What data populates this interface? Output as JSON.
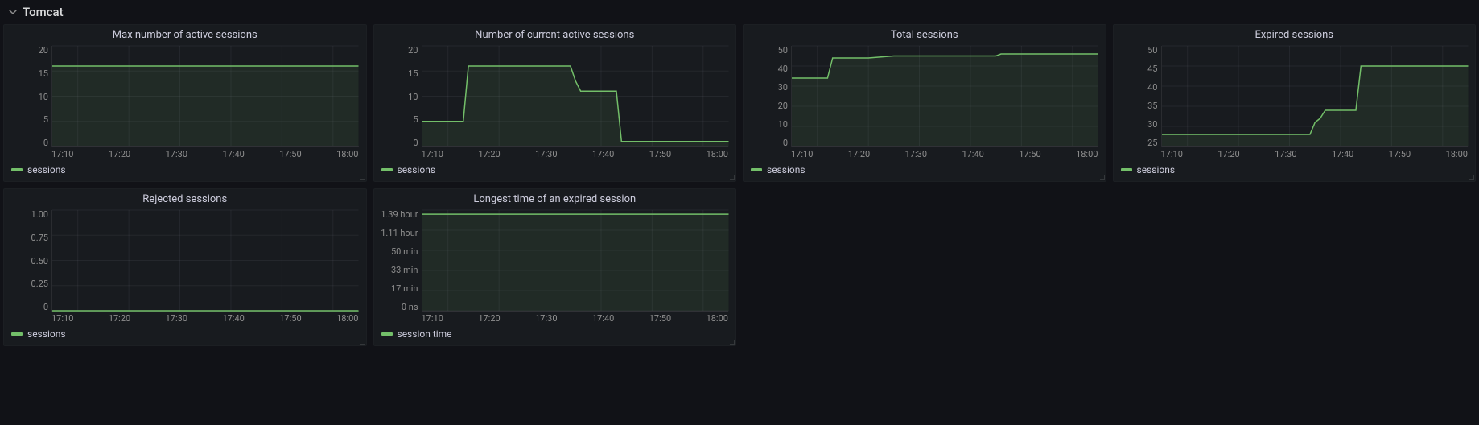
{
  "section": {
    "title": "Tomcat"
  },
  "x_ticks": [
    "17:10",
    "17:20",
    "17:30",
    "17:40",
    "17:50",
    "18:00"
  ],
  "colors": {
    "series": "#73bf69"
  },
  "chart_data": [
    {
      "id": "max-active",
      "type": "line",
      "title": "Max number of active sessions",
      "legend": "sessions",
      "ylim": [
        0,
        20
      ],
      "y_ticks": [
        "20",
        "15",
        "10",
        "5",
        "0"
      ],
      "x": [
        "17:05",
        "17:10",
        "17:15",
        "17:20",
        "17:25",
        "17:30",
        "17:35",
        "17:40",
        "17:45",
        "17:50",
        "17:55",
        "18:00",
        "18:05"
      ],
      "values": [
        16,
        16,
        16,
        16,
        16,
        16,
        16,
        16,
        16,
        16,
        16,
        16,
        16
      ]
    },
    {
      "id": "current-active",
      "type": "line",
      "title": "Number of current active sessions",
      "legend": "sessions",
      "ylim": [
        0,
        20
      ],
      "y_ticks": [
        "20",
        "15",
        "10",
        "5",
        "0"
      ],
      "x": [
        "17:05",
        "17:10",
        "17:13",
        "17:14",
        "17:20",
        "17:25",
        "17:30",
        "17:34",
        "17:35",
        "17:36",
        "17:43",
        "17:44",
        "17:50",
        "17:55",
        "18:00",
        "18:05"
      ],
      "values": [
        5,
        5,
        5,
        16,
        16,
        16,
        16,
        16,
        13,
        11,
        11,
        1,
        1,
        1,
        1,
        1
      ]
    },
    {
      "id": "total-sessions",
      "type": "line",
      "title": "Total sessions",
      "legend": "sessions",
      "ylim": [
        0,
        50
      ],
      "y_ticks": [
        "50",
        "40",
        "30",
        "20",
        "10",
        "0"
      ],
      "x": [
        "17:05",
        "17:10",
        "17:12",
        "17:13",
        "17:20",
        "17:25",
        "17:30",
        "17:35",
        "17:40",
        "17:45",
        "17:46",
        "17:50",
        "17:55",
        "18:00",
        "18:05"
      ],
      "values": [
        34,
        34,
        34,
        44,
        44,
        45,
        45,
        45,
        45,
        45,
        46,
        46,
        46,
        46,
        46
      ]
    },
    {
      "id": "expired-sessions",
      "type": "line",
      "title": "Expired sessions",
      "legend": "sessions",
      "ylim": [
        25,
        50
      ],
      "y_ticks": [
        "50",
        "45",
        "40",
        "35",
        "30",
        "25"
      ],
      "x": [
        "17:05",
        "17:10",
        "17:15",
        "17:20",
        "17:25",
        "17:30",
        "17:34",
        "17:35",
        "17:36",
        "17:37",
        "17:43",
        "17:44",
        "17:50",
        "17:55",
        "18:00",
        "18:05"
      ],
      "values": [
        28,
        28,
        28,
        28,
        28,
        28,
        28,
        31,
        32,
        34,
        34,
        45,
        45,
        45,
        45,
        45
      ]
    },
    {
      "id": "rejected-sessions",
      "type": "line",
      "title": "Rejected sessions",
      "legend": "sessions",
      "ylim": [
        0,
        1
      ],
      "y_ticks": [
        "1.00",
        "0.75",
        "0.50",
        "0.25",
        "0"
      ],
      "x": [
        "17:05",
        "17:10",
        "17:15",
        "17:20",
        "17:25",
        "17:30",
        "17:35",
        "17:40",
        "17:45",
        "17:50",
        "17:55",
        "18:00",
        "18:05"
      ],
      "values": [
        0,
        0,
        0,
        0,
        0,
        0,
        0,
        0,
        0,
        0,
        0,
        0,
        0
      ]
    },
    {
      "id": "longest-expired",
      "type": "line",
      "title": "Longest time of an expired session",
      "legend": "session time",
      "ylim": [
        0,
        5004
      ],
      "y_ticks": [
        "1.39 hour",
        "1.11 hour",
        "50 min",
        "33 min",
        "17 min",
        "0 ns"
      ],
      "x": [
        "17:05",
        "17:10",
        "17:15",
        "17:20",
        "17:25",
        "17:30",
        "17:35",
        "17:40",
        "17:45",
        "17:50",
        "17:55",
        "18:00",
        "18:05"
      ],
      "values": [
        4800,
        4800,
        4800,
        4800,
        4800,
        4800,
        4800,
        4800,
        4800,
        4800,
        4800,
        4800,
        4800
      ]
    }
  ]
}
